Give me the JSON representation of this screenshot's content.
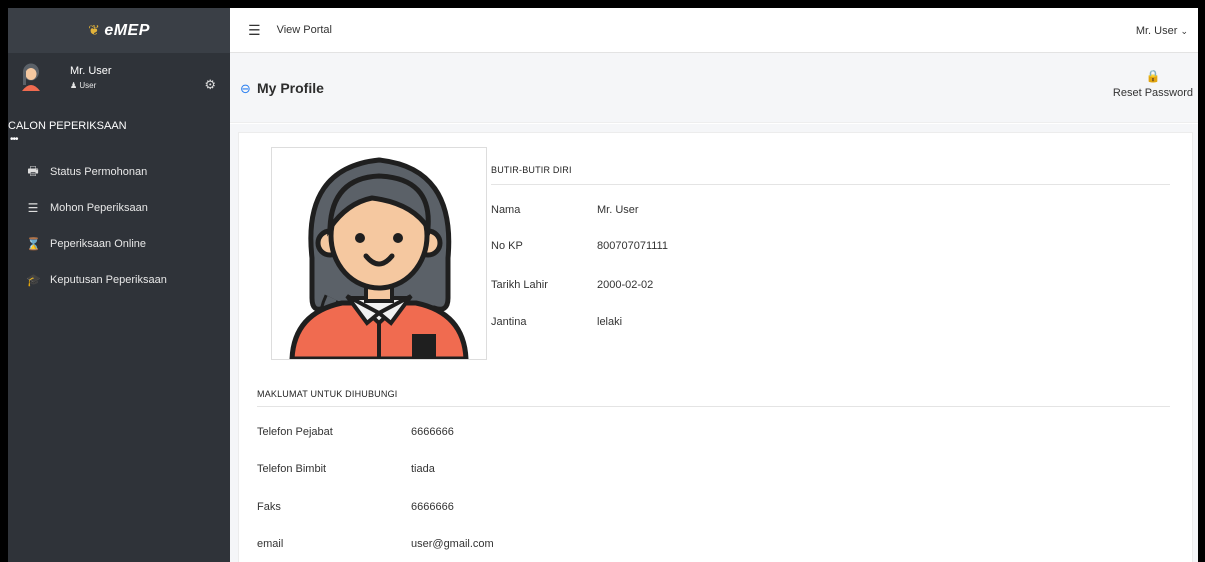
{
  "brand": {
    "name": "eMEP"
  },
  "sidebar": {
    "user_name": "Mr. User",
    "user_role": "User",
    "section_title": "CALON PEPERIKSAAN",
    "dots": "•••",
    "items": [
      {
        "label": "Status Permohonan",
        "icon": "printer-icon"
      },
      {
        "label": "Mohon Peperiksaan",
        "icon": "list-icon"
      },
      {
        "label": "Peperiksaan Online",
        "icon": "hourglass-icon"
      },
      {
        "label": "Keputusan Peperiksaan",
        "icon": "graduation-cap-icon"
      }
    ]
  },
  "topbar": {
    "view_portal": "View Portal",
    "user_menu": "Mr. User"
  },
  "header": {
    "title": "My Profile",
    "reset_password": "Reset Password"
  },
  "profile": {
    "personal_title": "BUTIR-BUTIR DIRI",
    "personal": [
      {
        "label": "Nama",
        "value": "Mr. User"
      },
      {
        "label": "No KP",
        "value": "800707071111"
      },
      {
        "label": "Tarikh Lahir",
        "value": "2000-02-02"
      },
      {
        "label": "Jantina",
        "value": "lelaki"
      }
    ],
    "contact_title": "MAKLUMAT UNTUK DIHUBUNGI",
    "contact": [
      {
        "label": "Telefon Pejabat",
        "value": "6666666"
      },
      {
        "label": "Telefon Bimbit",
        "value": "tiada"
      },
      {
        "label": "Faks",
        "value": "6666666"
      },
      {
        "label": "email",
        "value": "user@gmail.com"
      }
    ]
  },
  "colors": {
    "sidebar": "#2f3339",
    "accent": "#2a7ff0",
    "avatar_shirt": "#f06b50",
    "avatar_skin": "#f5c8a0",
    "avatar_hair": "#5b6168"
  }
}
